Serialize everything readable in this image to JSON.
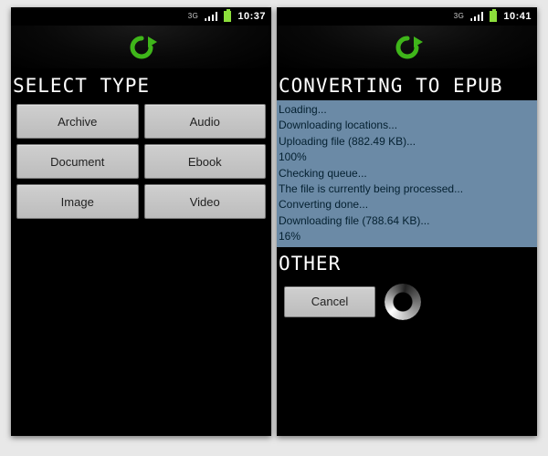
{
  "left": {
    "statusbar": {
      "signal_label": "3G",
      "clock": "10:37"
    },
    "heading": "SELECT TYPE",
    "buttons": {
      "b0": "Archive",
      "b1": "Audio",
      "b2": "Document",
      "b3": "Ebook",
      "b4": "Image",
      "b5": "Video"
    }
  },
  "right": {
    "statusbar": {
      "signal_label": "3G",
      "clock": "10:41"
    },
    "heading": "CONVERTING TO EPUB",
    "log": {
      "l0": "Loading...",
      "l1": "Downloading locations...",
      "l2": "Uploading file (882.49 KB)...",
      "l3": "100%",
      "l4": "Checking queue...",
      "l5": "The file is currently being processed...",
      "l6": "Converting done...",
      "l7": "Downloading file (788.64 KB)...",
      "l8": "16%"
    },
    "other_heading": "OTHER",
    "cancel_label": "Cancel"
  }
}
